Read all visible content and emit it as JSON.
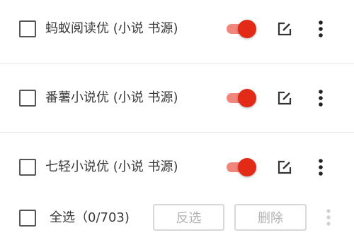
{
  "sources": [
    {
      "name": "蚂蚁阅读优 (小说 书源)",
      "enabled": true
    },
    {
      "name": "番薯小说优 (小说 书源)",
      "enabled": true
    },
    {
      "name": "七轻小说优 (小说 书源)",
      "enabled": true
    }
  ],
  "bottom_bar": {
    "select_all_label": "全选（0/703)",
    "invert_label": "反选",
    "delete_label": "删除"
  },
  "icons": {
    "edit": "edit-icon",
    "more": "more-vert-icon",
    "checkbox": "checkbox-unchecked-icon"
  },
  "colors": {
    "switch_thumb": "#e22a17",
    "switch_track": "#f0867c",
    "disabled_text": "#b3b3b3",
    "divider": "#e6e6e6"
  }
}
